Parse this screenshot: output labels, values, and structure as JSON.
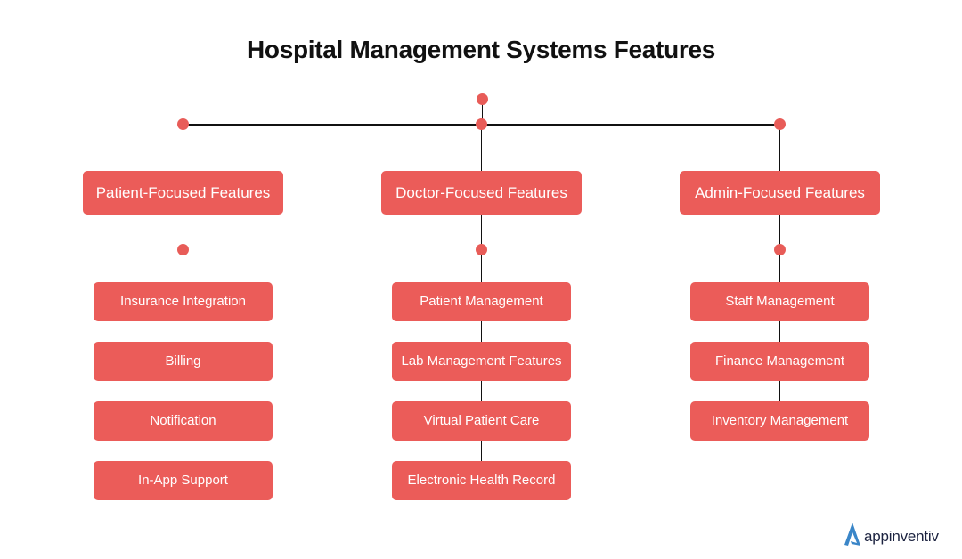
{
  "title": "Hospital Management Systems Features",
  "colors": {
    "box": "#eb5c59",
    "dot": "#e85c58",
    "line": "#111111",
    "logo_accent": "#3a86c8",
    "logo_text": "#1c2340"
  },
  "categories": [
    {
      "label": "Patient-Focused Features",
      "items": [
        "Insurance Integration",
        "Billing",
        "Notification",
        "In-App Support"
      ]
    },
    {
      "label": "Doctor-Focused Features",
      "items": [
        "Patient Management",
        "Lab Management Features",
        "Virtual Patient Care",
        "Electronic Health Record"
      ]
    },
    {
      "label": "Admin-Focused Features",
      "items": [
        "Staff Management",
        "Finance Management",
        "Inventory Management"
      ]
    }
  ],
  "logo": {
    "icon": "appinventiv-a-icon",
    "text": "appinventiv"
  }
}
